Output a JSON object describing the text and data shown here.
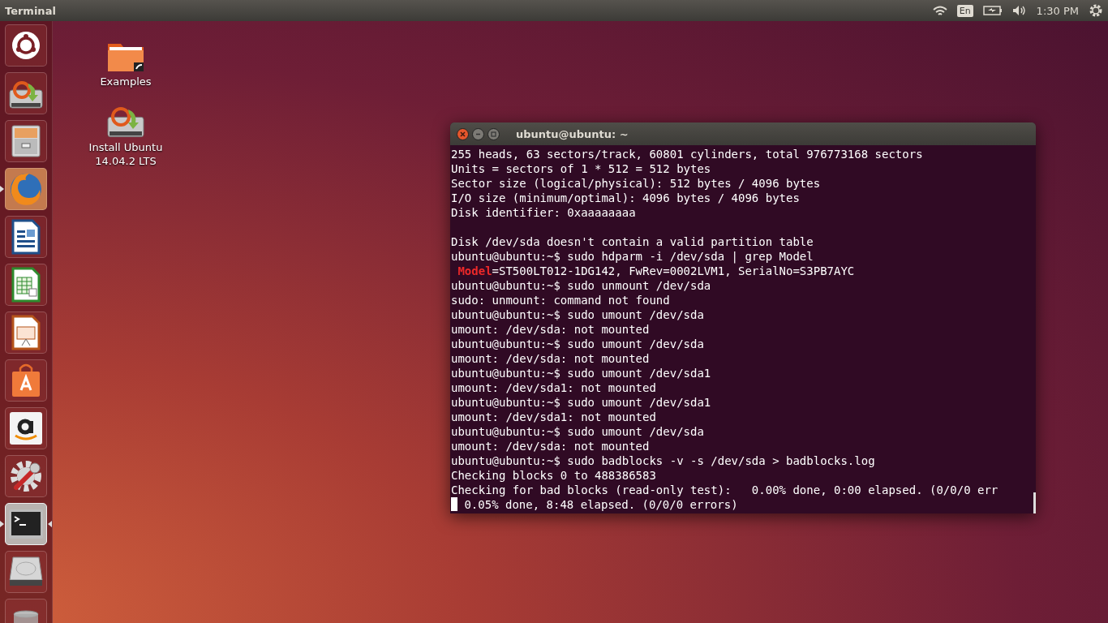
{
  "top_bar": {
    "app_title": "Terminal",
    "keyboard": "En",
    "clock": "1:30 PM"
  },
  "launcher": [
    {
      "kind": "dash",
      "running": false,
      "focused": false
    },
    {
      "kind": "installer",
      "running": false,
      "focused": false
    },
    {
      "kind": "files",
      "running": false,
      "focused": false
    },
    {
      "kind": "browser",
      "running": true,
      "focused": false
    },
    {
      "kind": "writer",
      "running": false,
      "focused": false
    },
    {
      "kind": "calc",
      "running": false,
      "focused": false
    },
    {
      "kind": "impress",
      "running": false,
      "focused": false
    },
    {
      "kind": "store",
      "running": false,
      "focused": false
    },
    {
      "kind": "amazon",
      "running": false,
      "focused": false
    },
    {
      "kind": "settings",
      "running": false,
      "focused": false
    },
    {
      "kind": "terminal",
      "running": true,
      "focused": true
    },
    {
      "kind": "drive",
      "running": false,
      "focused": false
    },
    {
      "kind": "trash",
      "running": false,
      "focused": false
    }
  ],
  "desktop_icons": [
    {
      "kind": "folder",
      "label": "Examples"
    },
    {
      "kind": "installer",
      "label": "Install Ubuntu\n14.04.2 LTS"
    }
  ],
  "terminal": {
    "title": "ubuntu@ubuntu: ~",
    "lines": [
      {
        "kind": "text",
        "text": "255 heads, 63 sectors/track, 60801 cylinders, total 976773168 sectors"
      },
      {
        "kind": "text",
        "text": "Units = sectors of 1 * 512 = 512 bytes"
      },
      {
        "kind": "text",
        "text": "Sector size (logical/physical): 512 bytes / 4096 bytes"
      },
      {
        "kind": "text",
        "text": "I/O size (minimum/optimal): 4096 bytes / 4096 bytes"
      },
      {
        "kind": "text",
        "text": "Disk identifier: 0xaaaaaaaa"
      },
      {
        "kind": "blank"
      },
      {
        "kind": "text",
        "text": "Disk /dev/sda doesn't contain a valid partition table"
      },
      {
        "kind": "text",
        "text": "ubuntu@ubuntu:~$ sudo hdparm -i /dev/sda | grep Model"
      },
      {
        "kind": "match",
        "match": " Model",
        "after": "=ST500LT012-1DG142, FwRev=0002LVM1, SerialNo=S3PB7AYC"
      },
      {
        "kind": "text",
        "text": "ubuntu@ubuntu:~$ sudo unmount /dev/sda"
      },
      {
        "kind": "text",
        "text": "sudo: unmount: command not found"
      },
      {
        "kind": "text",
        "text": "ubuntu@ubuntu:~$ sudo umount /dev/sda"
      },
      {
        "kind": "text",
        "text": "umount: /dev/sda: not mounted"
      },
      {
        "kind": "text",
        "text": "ubuntu@ubuntu:~$ sudo umount /dev/sda"
      },
      {
        "kind": "text",
        "text": "umount: /dev/sda: not mounted"
      },
      {
        "kind": "text",
        "text": "ubuntu@ubuntu:~$ sudo umount /dev/sda1"
      },
      {
        "kind": "text",
        "text": "umount: /dev/sda1: not mounted"
      },
      {
        "kind": "text",
        "text": "ubuntu@ubuntu:~$ sudo umount /dev/sda1"
      },
      {
        "kind": "text",
        "text": "umount: /dev/sda1: not mounted"
      },
      {
        "kind": "text",
        "text": "ubuntu@ubuntu:~$ sudo umount /dev/sda"
      },
      {
        "kind": "text",
        "text": "umount: /dev/sda: not mounted"
      },
      {
        "kind": "text",
        "text": "ubuntu@ubuntu:~$ sudo badblocks -v -s /dev/sda > badblocks.log"
      },
      {
        "kind": "text",
        "text": "Checking blocks 0 to 488386583"
      },
      {
        "kind": "text",
        "text": "Checking for bad blocks (read-only test):   0.00% done, 0:00 elapsed. (0/0/0 err"
      },
      {
        "kind": "cursor",
        "text": " 0.05% done, 8:48 elapsed. (0/0/0 errors)"
      }
    ]
  }
}
